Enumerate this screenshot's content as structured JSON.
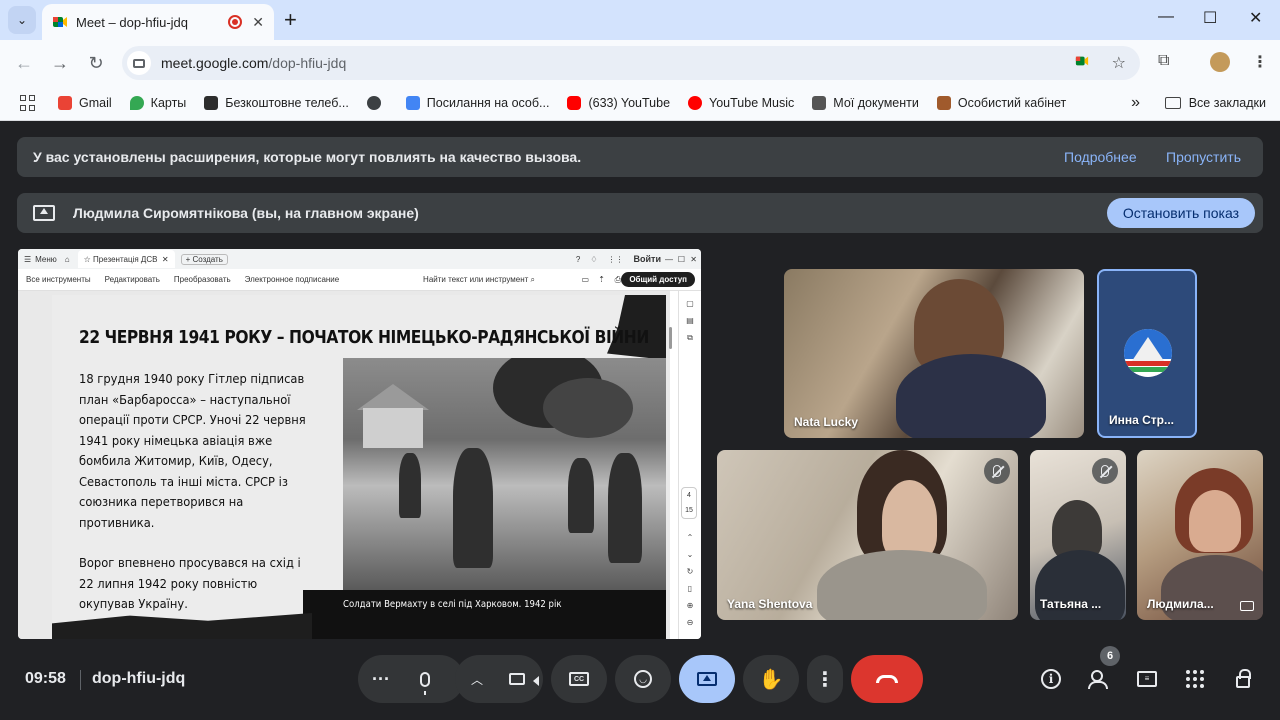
{
  "browser": {
    "tab_title": "Meet – dop-hfiu-jdq",
    "url_host": "meet.google.com",
    "url_path": "/dop-hfiu-jdq",
    "bookmarks": [
      {
        "label": "Gmail",
        "color": "#ea4335"
      },
      {
        "label": "Карты",
        "color": "#34a853"
      },
      {
        "label": "Безкоштовне телеб...",
        "color": "#2d2d2d"
      },
      {
        "label": "",
        "color": "#3c4043"
      },
      {
        "label": "Посилання на особ...",
        "color": "#4285f4"
      },
      {
        "label": "(633) YouTube",
        "color": "#ff0000"
      },
      {
        "label": "YouTube Music",
        "color": "#ff0000"
      },
      {
        "label": "Мої документи",
        "color": "#555555"
      },
      {
        "label": "Особистий кабінет",
        "color": "#a05a2c"
      }
    ],
    "all_bookmarks": "Все закладки"
  },
  "banner_extensions": {
    "text": "У вас установлены расширения, которые могут повлиять на качество вызова.",
    "more": "Подробнее",
    "skip": "Пропустить"
  },
  "banner_presenting": {
    "text": "Людмила Сиромятнікова (вы, на главном экране)",
    "stop": "Остановить показ"
  },
  "shared_screen": {
    "toolbar": {
      "menu": "Меню",
      "tab": "Презентація ДСВ",
      "create": "+ Создать",
      "signin": "Войти",
      "items": [
        "Все инструменты",
        "Редактировать",
        "Преобразовать",
        "Электронное подписание"
      ],
      "find": "Найти текст или инструмент",
      "share": "Общий доступ"
    },
    "page_current": "4",
    "page_total": "15",
    "slide": {
      "title": "22 ЧЕРВНЯ 1941 РОКУ – ПОЧАТОК НІМЕЦЬКО-РАДЯНСЬКОЇ ВІЙНИ",
      "para1": "18 грудня 1940 року Гітлер підписав план «Барбаросса» – наступальної операції проти СРСР. Уночі 22 червня 1941 року німецька авіація вже бомбила Житомир, Київ, Одесу, Севастополь та інші міста.  СРСР із союзника перетворився на противника.",
      "para2": "Ворог впевнено просувався на схід і 22 липня 1942 року повністю окупував Україну.",
      "caption": "Солдати Вермахту в селі під Харковом. 1942 рік"
    }
  },
  "participants": [
    {
      "name": "Nata Lucky"
    },
    {
      "name": "Инна Стр..."
    },
    {
      "name": "Yana Shentova"
    },
    {
      "name": "Татьяна ..."
    },
    {
      "name": "Людмила..."
    }
  ],
  "controls": {
    "time": "09:58",
    "meeting_code": "dop-hfiu-jdq",
    "people_count": "6"
  }
}
